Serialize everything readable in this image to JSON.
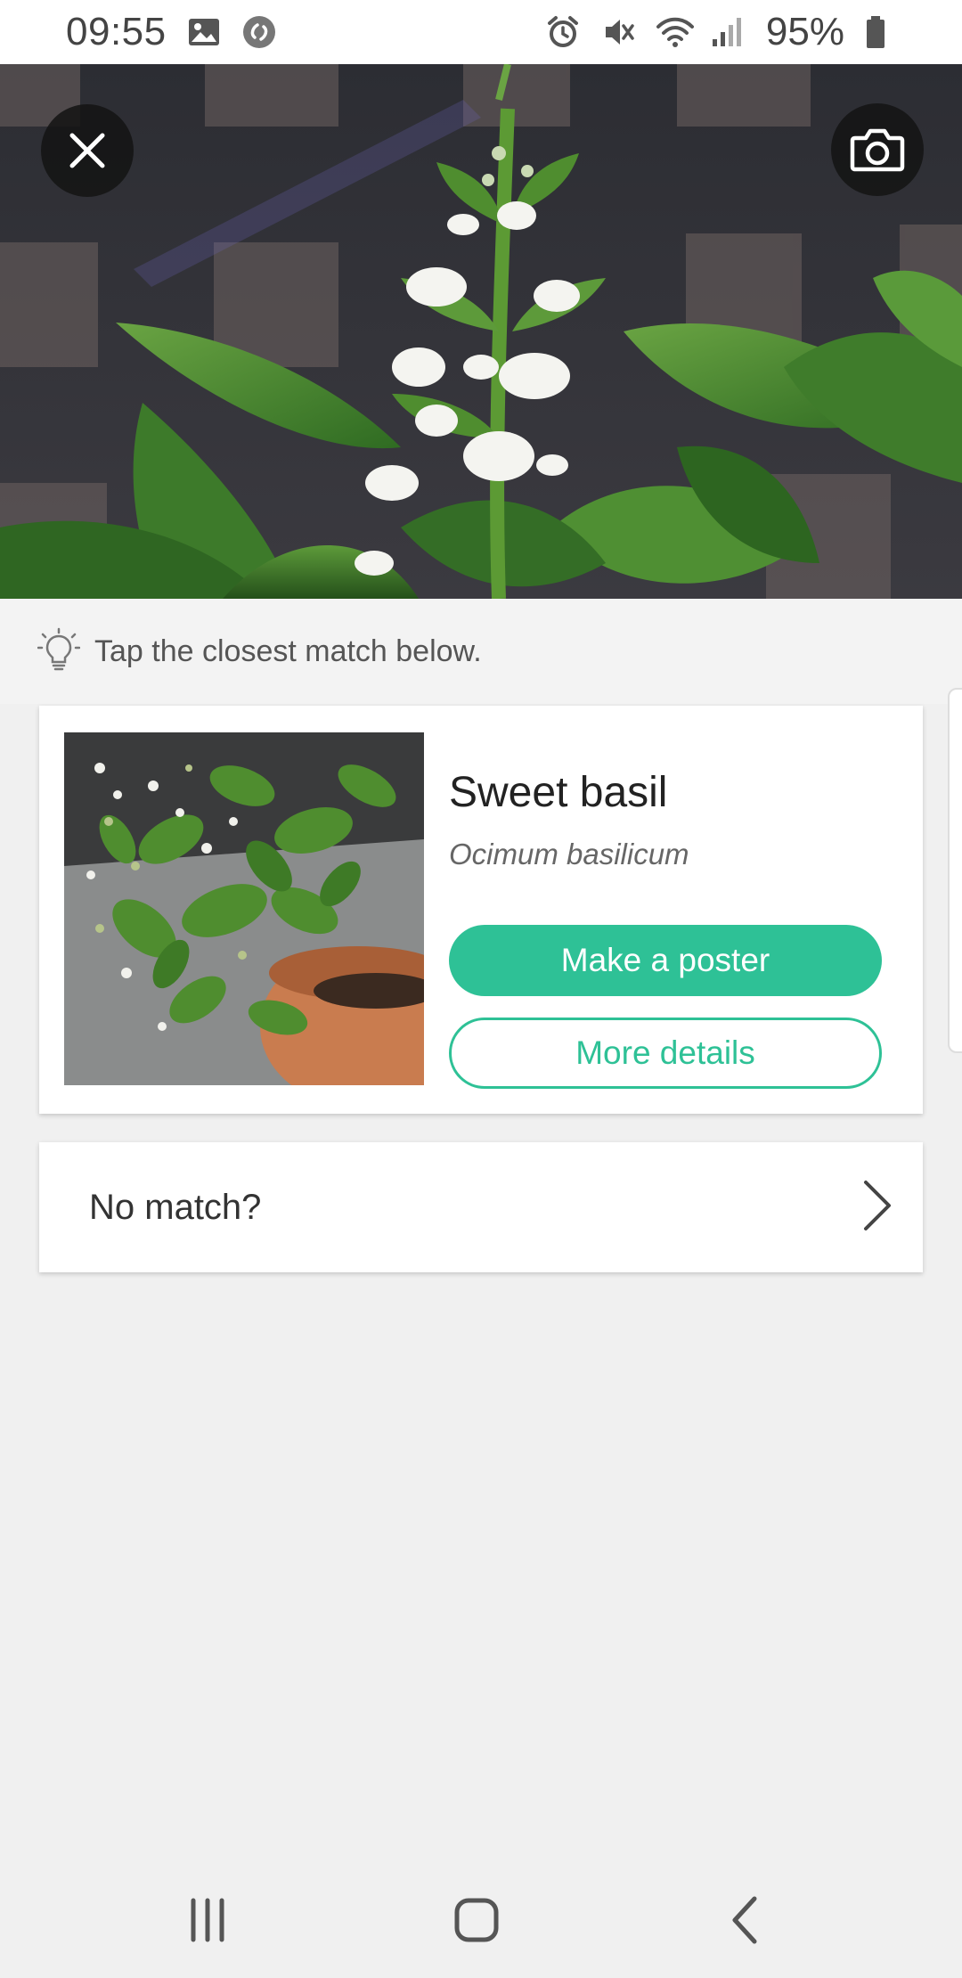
{
  "status_bar": {
    "time": "09:55",
    "battery_percent": "95%",
    "left_icons": [
      "gallery-icon",
      "shazam-icon"
    ],
    "right_icons": [
      "alarm-icon",
      "vibrate-mute-icon",
      "wifi-icon",
      "signal-icon",
      "battery-icon"
    ]
  },
  "hero": {
    "close_icon": "close-icon",
    "camera_icon": "camera-icon"
  },
  "hint": {
    "icon": "lightbulb-icon",
    "text": "Tap the closest match below."
  },
  "match": {
    "common_name": "Sweet basil",
    "scientific_name": "Ocimum basilicum",
    "primary_button": "Make a poster",
    "secondary_button": "More details"
  },
  "no_match": {
    "label": "No match?",
    "icon": "chevron-right-icon"
  },
  "nav_bar": {
    "buttons": [
      "recents-icon",
      "home-icon",
      "back-icon"
    ]
  },
  "colors": {
    "accent": "#2ec196",
    "background": "#f0f0f0",
    "card": "#ffffff"
  }
}
